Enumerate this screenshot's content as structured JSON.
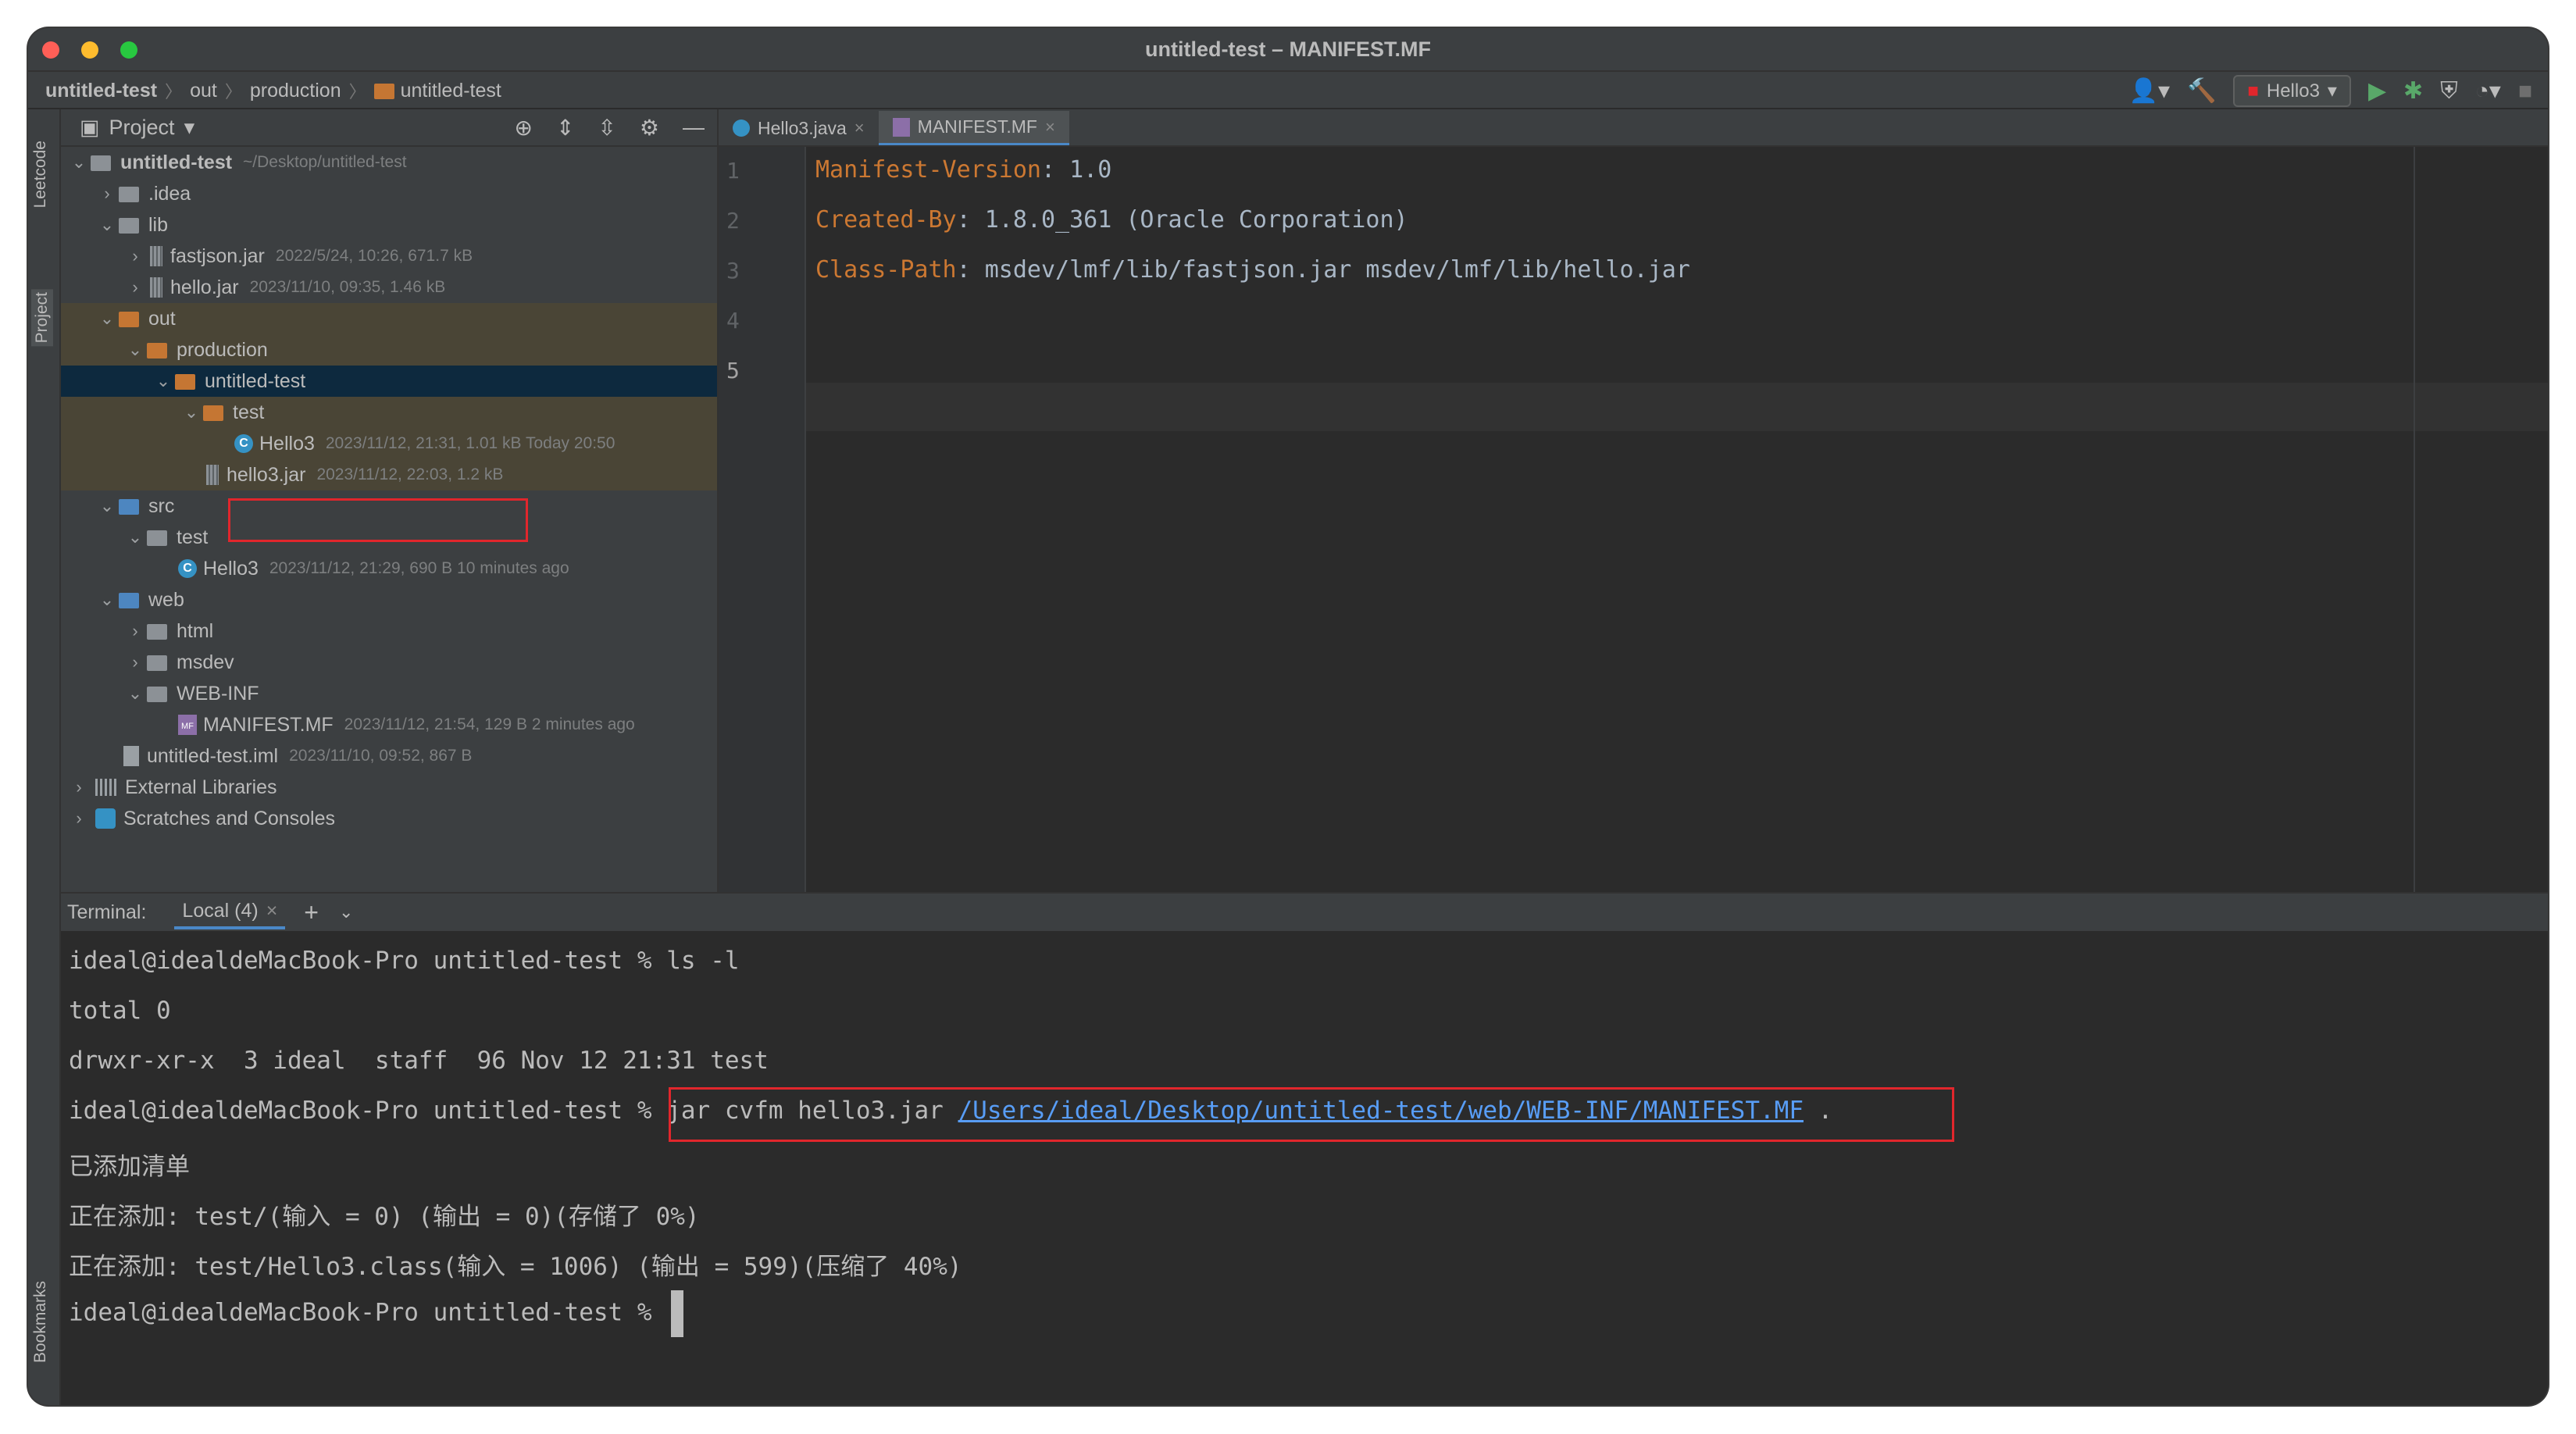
{
  "window": {
    "title": "untitled-test – MANIFEST.MF"
  },
  "breadcrumb": [
    "untitled-test",
    "out",
    "production",
    "untitled-test"
  ],
  "toolbar": {
    "run_config": "Hello3"
  },
  "side_tabs": {
    "leetcode": "Leetcode",
    "project": "Project",
    "bookmarks": "Bookmarks"
  },
  "project_panel": {
    "title": "Project"
  },
  "tree": [
    {
      "name": "untitled-test",
      "meta": "~/Desktop/untitled-test"
    },
    {
      "name": ".idea",
      "meta": ""
    },
    {
      "name": "lib",
      "meta": ""
    },
    {
      "name": "fastjson.jar",
      "meta": "2022/5/24, 10:26, 671.7 kB"
    },
    {
      "name": "hello.jar",
      "meta": "2023/11/10, 09:35, 1.46 kB"
    },
    {
      "name": "out",
      "meta": ""
    },
    {
      "name": "production",
      "meta": ""
    },
    {
      "name": "untitled-test",
      "meta": ""
    },
    {
      "name": "test",
      "meta": ""
    },
    {
      "name": "Hello3",
      "meta": "2023/11/12, 21:31, 1.01 kB Today 20:50"
    },
    {
      "name": "hello3.jar",
      "meta": "2023/11/12, 22:03, 1.2 kB"
    },
    {
      "name": "src",
      "meta": ""
    },
    {
      "name": "test",
      "meta": ""
    },
    {
      "name": "Hello3",
      "meta": "2023/11/12, 21:29, 690 B 10 minutes ago"
    },
    {
      "name": "web",
      "meta": ""
    },
    {
      "name": "html",
      "meta": ""
    },
    {
      "name": "msdev",
      "meta": ""
    },
    {
      "name": "WEB-INF",
      "meta": ""
    },
    {
      "name": "MANIFEST.MF",
      "meta": "2023/11/12, 21:54, 129 B 2 minutes ago"
    },
    {
      "name": "untitled-test.iml",
      "meta": "2023/11/10, 09:52, 867 B"
    },
    {
      "name": "External Libraries",
      "meta": ""
    },
    {
      "name": "Scratches and Consoles",
      "meta": ""
    }
  ],
  "editor": {
    "tabs": [
      {
        "label": "Hello3.java",
        "close": "×"
      },
      {
        "label": "MANIFEST.MF",
        "close": "×"
      }
    ],
    "line_numbers": [
      "1",
      "2",
      "3",
      "4",
      "5"
    ],
    "lines": [
      {
        "key": "Manifest-Version",
        "value": ": 1.0"
      },
      {
        "key": "Created-By",
        "value": ": 1.8.0_361 (Oracle Corporation)"
      },
      {
        "key": "Class-Path",
        "value": ": msdev/lmf/lib/fastjson.jar msdev/lmf/lib/hello.jar"
      }
    ]
  },
  "terminal": {
    "label": "Terminal:",
    "tab": "Local (4)",
    "tab_close": "×",
    "prompt": "ideal@idealdeMacBook-Pro untitled-test % ",
    "lines": [
      "ls -l",
      "total 0",
      "drwxr-xr-x  3 ideal  staff  96 Nov 12 21:31 test",
      "已添加清单",
      "正在添加: test/(输入 = 0) (输出 = 0)(存储了 0%)",
      "正在添加: test/Hello3.class(输入 = 1006) (输出 = 599)(压缩了 40%)"
    ],
    "cmd_prefix": "jar cvfm hello3.jar ",
    "cmd_link": "/Users/ideal/Desktop/untitled-test/web/WEB-INF/MANIFEST.MF",
    "cmd_suffix": " ."
  }
}
